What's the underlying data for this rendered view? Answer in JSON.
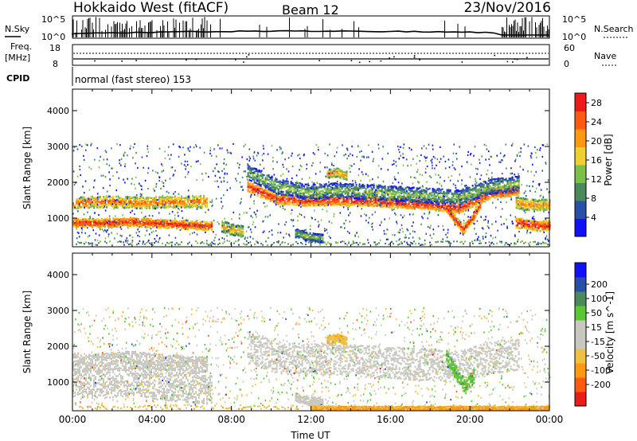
{
  "header": {
    "station": "Hokkaido West (fitACF)",
    "beam": "Beam 12",
    "date": "23/Nov/2016"
  },
  "top_panels": {
    "nsky_label": "N.Sky",
    "nsky_top_tick": "10^5",
    "nsky_bottom_tick": "10^0",
    "nsearch_label": "N.Search",
    "nsearch_top_tick": "10^5",
    "nsearch_bottom_tick": "10^0",
    "freq_label_line1": "Freq.",
    "freq_label_line2": "[MHz]",
    "freq_top_tick": "18",
    "freq_bottom_tick": "8",
    "nave_label": "Nave",
    "nave_top_tick": "60",
    "nave_bottom_tick": "0",
    "cpid_label": "CPID",
    "cpid_text": "normal (fast stereo) 153"
  },
  "colors": {
    "power_scale": [
      "#1010ff",
      "#2a4fa8",
      "#4a8a5a",
      "#7cc04a",
      "#f0d030",
      "#ff9a10",
      "#ff5a10",
      "#ee1a1a"
    ],
    "velocity_scale": [
      "#ee1a1a",
      "#ff5a10",
      "#ff9a10",
      "#f0c040",
      "#c8c8c0",
      "#c8c8c0",
      "#5ac830",
      "#4a8a5a",
      "#2a4fa8",
      "#1010ff"
    ]
  },
  "chart_data": [
    {
      "type": "heatmap",
      "panel": "power",
      "ylabel": "Slant Range [km]",
      "xlabel": "",
      "x_ticks": [
        "00:00",
        "04:00",
        "08:00",
        "12:00",
        "16:00",
        "20:00",
        "00:00"
      ],
      "y_ticks": [
        1000,
        2000,
        3000,
        4000
      ],
      "ylim": [
        200,
        4600
      ],
      "xlim_hours": [
        0,
        24
      ],
      "colorbar_label": "Power [dB]",
      "colorbar_ticks": [
        4,
        8,
        12,
        16,
        20,
        24,
        28
      ],
      "colorbar_range": [
        0,
        30
      ],
      "scatter_bands": [
        {
          "from_h": 0,
          "to_h": 7,
          "center_km": [
            900,
            880,
            900,
            920,
            880,
            850,
            820,
            800
          ],
          "width_km": 150,
          "level": 28
        },
        {
          "from_h": 0,
          "to_h": 6.8,
          "center_km": [
            1450,
            1470,
            1480,
            1460,
            1450,
            1470,
            1480,
            1500
          ],
          "width_km": 200,
          "level": 24
        },
        {
          "from_h": 8.8,
          "to_h": 22.5,
          "center_km": [
            1900,
            1550,
            1500,
            1520,
            1500,
            1450,
            1400,
            1300,
            1700,
            1800
          ],
          "width_km": 180,
          "level": 28
        },
        {
          "from_h": 8.8,
          "to_h": 22.5,
          "center_km": [
            2300,
            1900,
            1750,
            1800,
            1750,
            1700,
            1650,
            1600,
            1900,
            2000
          ],
          "width_km": 260,
          "level": 14
        },
        {
          "from_h": 18.8,
          "to_h": 20.5,
          "center_km": [
            1300,
            1000,
            700,
            1000,
            1400
          ],
          "width_km": 150,
          "level": 28
        },
        {
          "from_h": 22.3,
          "to_h": 24,
          "center_km": [
            900,
            850,
            800,
            820
          ],
          "width_km": 180,
          "level": 28
        },
        {
          "from_h": 22.3,
          "to_h": 24,
          "center_km": [
            1450,
            1400,
            1380,
            1400
          ],
          "width_km": 200,
          "level": 22
        },
        {
          "from_h": 12.8,
          "to_h": 13.8,
          "center_km": [
            2250,
            2300,
            2200
          ],
          "width_km": 150,
          "level": 22
        },
        {
          "from_h": 7.5,
          "to_h": 8.6,
          "center_km": [
            800,
            700,
            650
          ],
          "width_km": 200,
          "level": 20
        },
        {
          "from_h": 11.2,
          "to_h": 12.6,
          "center_km": [
            600,
            500,
            450
          ],
          "width_km": 150,
          "level": 14
        }
      ]
    },
    {
      "type": "heatmap",
      "panel": "velocity",
      "ylabel": "Slant Range [km]",
      "xlabel": "Time UT",
      "x_ticks": [
        "00:00",
        "04:00",
        "08:00",
        "12:00",
        "16:00",
        "20:00",
        "00:00"
      ],
      "y_ticks": [
        1000,
        2000,
        3000,
        4000
      ],
      "ylim": [
        200,
        4600
      ],
      "xlim_hours": [
        0,
        24
      ],
      "colorbar_label": "Velocity [m s^-1]",
      "colorbar_ticks": [
        -200,
        -100,
        -50,
        -15,
        15,
        50,
        100,
        200
      ],
      "colorbar_range": [
        -250,
        250
      ],
      "scatter_bands": [
        {
          "from_h": 0,
          "to_h": 7,
          "center_km": [
            1000,
            950,
            1000,
            1050,
            950,
            900,
            850,
            800
          ],
          "width_km": 500,
          "level": 0
        },
        {
          "from_h": 0,
          "to_h": 6.8,
          "center_km": [
            1600,
            1550,
            1600,
            1650,
            1600,
            1550,
            1500,
            1500
          ],
          "width_km": 300,
          "level": 0
        },
        {
          "from_h": 8.8,
          "to_h": 22.5,
          "center_km": [
            2000,
            1700,
            1650,
            1650,
            1600,
            1550,
            1500,
            1450,
            1700,
            1800
          ],
          "width_km": 550,
          "level": 0
        },
        {
          "from_h": 18.8,
          "to_h": 20.2,
          "center_km": [
            1700,
            1300,
            900,
            1200
          ],
          "width_km": 250,
          "level": 40
        },
        {
          "from_h": 12.8,
          "to_h": 13.8,
          "center_km": [
            2200,
            2250,
            2150
          ],
          "width_km": 150,
          "level": -40
        },
        {
          "from_h": 11.2,
          "to_h": 12.6,
          "center_km": [
            600,
            500,
            450
          ],
          "width_km": 150,
          "level": 0
        },
        {
          "from_h": 12,
          "to_h": 24,
          "center_km": [
            280,
            280,
            280
          ],
          "width_km": 80,
          "level": -60
        }
      ]
    }
  ]
}
